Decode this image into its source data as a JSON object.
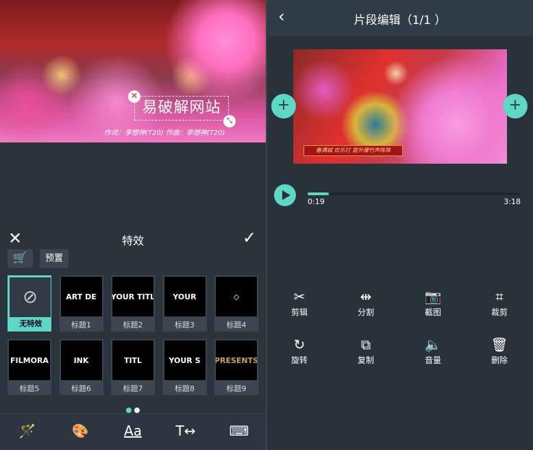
{
  "left": {
    "overlay_text": "易破解网站",
    "subtitle": "作词：李想神(T20)  作曲：李想神(T20)",
    "panel_title": "特效",
    "preset_label": "预置",
    "effects": [
      {
        "label": "无特效",
        "thumb": "⊘",
        "selected": true
      },
      {
        "label": "标题1",
        "thumb": "ART DE"
      },
      {
        "label": "标题2",
        "thumb": "YOUR TITL"
      },
      {
        "label": "标题3",
        "thumb": "YOUR"
      },
      {
        "label": "标题4",
        "thumb": "◇"
      },
      {
        "label": "标题5",
        "thumb": "FILMORA"
      },
      {
        "label": "标题6",
        "thumb": "INK"
      },
      {
        "label": "标题7",
        "thumb": "TITL"
      },
      {
        "label": "标题8",
        "thumb": "YOUR S"
      },
      {
        "label": "标题9",
        "thumb": "PRESENTS"
      }
    ],
    "page_count": 2,
    "current_page": 1,
    "bottom_nav": [
      "magic-wand-icon",
      "palette-icon",
      "font-icon",
      "text-spacing-icon",
      "keyboard-icon"
    ]
  },
  "right": {
    "title": "片段编辑（1/1 ）",
    "video_banner": "春满城 欢乐灯 首外爆竹声阵阵",
    "current_time": "0:19",
    "total_time": "3:18",
    "progress_fraction": 0.1,
    "tools": [
      {
        "label": "剪辑",
        "icon": "scissors-icon",
        "glyph": "✂"
      },
      {
        "label": "分割",
        "icon": "split-icon",
        "glyph": "⇹"
      },
      {
        "label": "截图",
        "icon": "camera-icon",
        "glyph": "📷"
      },
      {
        "label": "裁剪",
        "icon": "crop-icon",
        "glyph": "⌗"
      },
      {
        "label": "旋转",
        "icon": "rotate-icon",
        "glyph": "↻"
      },
      {
        "label": "复制",
        "icon": "duplicate-icon",
        "glyph": "⧉"
      },
      {
        "label": "音量",
        "icon": "volume-icon",
        "glyph": "🔈"
      },
      {
        "label": "删除",
        "icon": "trash-icon",
        "glyph": "🗑"
      }
    ]
  },
  "colors": {
    "accent": "#5fd6c6",
    "background": "#28323b",
    "header": "#2f3b45"
  }
}
